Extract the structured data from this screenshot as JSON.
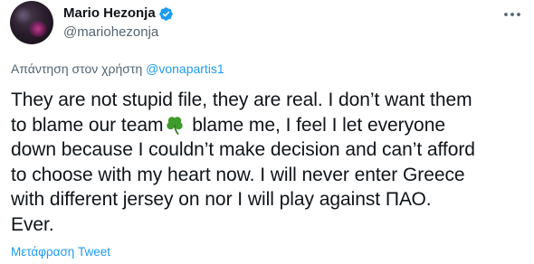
{
  "author": {
    "display_name": "Mario Hezonja",
    "handle": "@mariohezonja",
    "verified": true,
    "avatar_icon": "profile-photo"
  },
  "menu": {
    "icon": "more-horizontal-icon"
  },
  "reply_context": {
    "prefix": "Απάντηση στον χρήστη",
    "mention": "@vonapartis1"
  },
  "tweet": {
    "line_1": "They are not stupid file, they are real. I don’t want them",
    "line_2_before_emoji": "to blame our team",
    "emoji_icon": "shamrock-icon",
    "line_2_after_emoji": " blame me, I feel I let everyone",
    "line_3": "down because I couldn’t make decision and can’t afford",
    "line_4": "to choose with my heart now. I will never enter Greece",
    "line_5": "with different jersey on nor I will play against ΠΑΟ.",
    "line_6": "Ever."
  },
  "translate": {
    "label": "Μετάφραση Tweet"
  },
  "colors": {
    "text_primary": "#0f1419",
    "text_secondary": "#536471",
    "accent": "#1d9bf0",
    "shamrock": "#3e9b2c",
    "background": "#ffffff"
  }
}
